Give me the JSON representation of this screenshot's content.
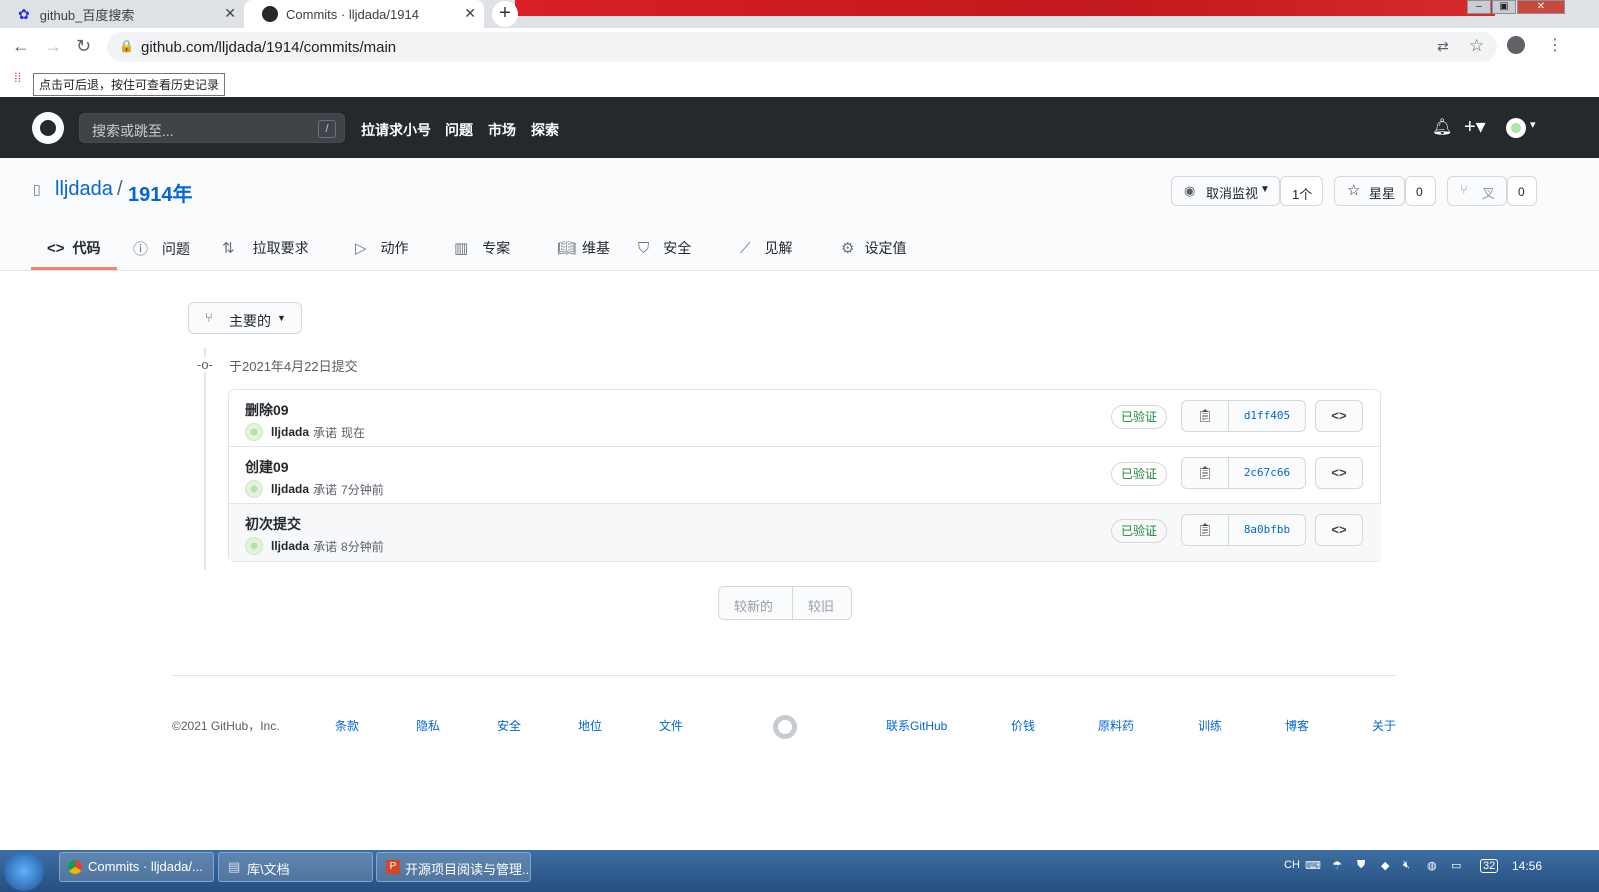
{
  "browser": {
    "tabs": [
      {
        "title": "github_百度搜索",
        "icon": "baidu-paw-icon"
      },
      {
        "title": "Commits · lljdada/1914",
        "icon": "github-icon"
      }
    ],
    "url": "github.com/lljdada/1914/commits/main",
    "tooltip": "点击可后退，按住可查看历史记录"
  },
  "github": {
    "search_placeholder": "搜索或跳至...",
    "search_shortcut": "/",
    "nav": [
      "拉请求小号",
      "问题",
      "市场",
      "探索"
    ]
  },
  "repo": {
    "owner": "lljdada",
    "separator": "/",
    "name": "1914年",
    "watch_label": "取消监视",
    "watch_count": "1个",
    "star_label": "星星",
    "star_count": "0",
    "fork_label": "叉",
    "fork_count": "0",
    "tabs": [
      {
        "label": "代码",
        "icon": "code-icon",
        "active": true
      },
      {
        "label": "问题",
        "icon": "issue-icon"
      },
      {
        "label": "拉取要求",
        "icon": "pull-request-icon"
      },
      {
        "label": "动作",
        "icon": "play-icon"
      },
      {
        "label": "专案",
        "icon": "project-icon"
      },
      {
        "label": "维基",
        "icon": "book-icon"
      },
      {
        "label": "安全",
        "icon": "shield-icon"
      },
      {
        "label": "见解",
        "icon": "graph-icon"
      },
      {
        "label": "设定值",
        "icon": "gear-icon"
      }
    ]
  },
  "commits": {
    "branch": "主要的",
    "date_heading": "于2021年4月22日提交",
    "items": [
      {
        "title": "删除09",
        "author": "lljdada",
        "verb": "承诺",
        "time": "现在",
        "verified": "已验证",
        "sha": "d1ff405"
      },
      {
        "title": "创建09",
        "author": "lljdada",
        "verb": "承诺",
        "time": "7分钟前",
        "verified": "已验证",
        "sha": "2c67c66"
      },
      {
        "title": "初次提交",
        "author": "lljdada",
        "verb": "承诺",
        "time": "8分钟前",
        "verified": "已验证",
        "sha": "8a0bfbb"
      }
    ],
    "pager_newer": "较新的",
    "pager_older": "较旧"
  },
  "footer": {
    "copyright": "©2021 GitHub，Inc.",
    "left_links": [
      "条款",
      "隐私",
      "安全",
      "地位",
      "文件"
    ],
    "right_links": [
      "联系GitHub",
      "价钱",
      "原料药",
      "训练",
      "博客",
      "关于"
    ]
  },
  "taskbar": {
    "items": [
      "Commits · lljdada/...",
      "库\\文档",
      "开源项目阅读与管理..."
    ],
    "lang": "CH",
    "clock": "14:56",
    "badge": "32"
  },
  "colors": {
    "header": "#24292e",
    "link": "#0366d6",
    "verified": "#22863a",
    "active_tab": "#f9826c"
  }
}
